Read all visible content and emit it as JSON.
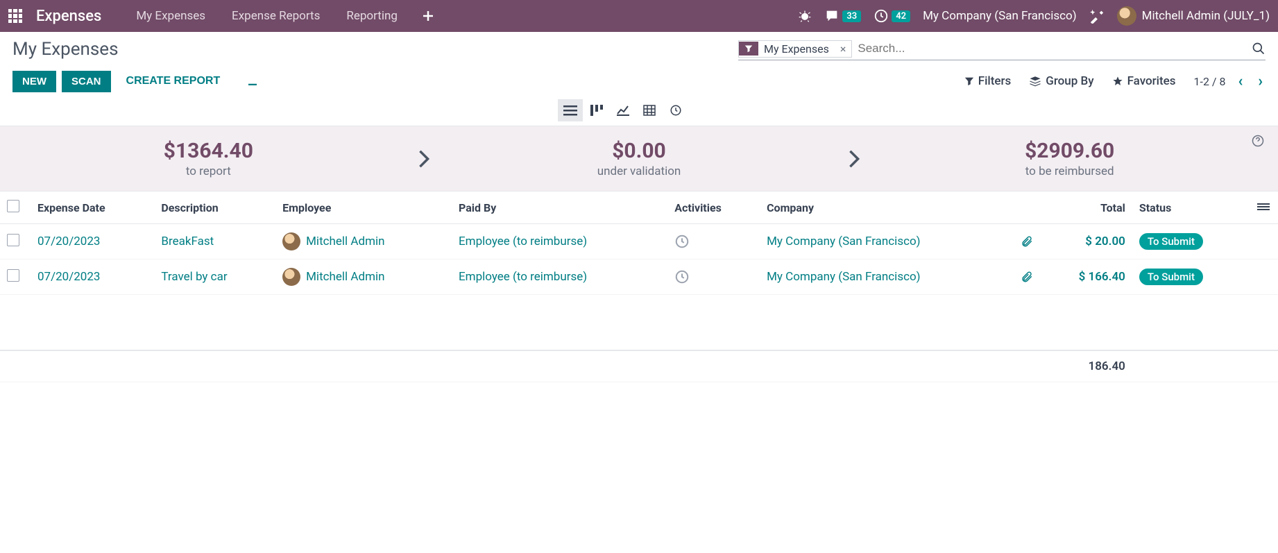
{
  "topbar": {
    "app_name": "Expenses",
    "nav": [
      "My Expenses",
      "Expense Reports",
      "Reporting"
    ],
    "msg_count": "33",
    "activity_count": "42",
    "company": "My Company (San Francisco)",
    "user": "Mitchell Admin (JULY_1)"
  },
  "breadcrumb": "My Expenses",
  "buttons": {
    "new": "NEW",
    "scan": "SCAN",
    "create_report": "CREATE REPORT"
  },
  "search": {
    "chip_label": "My Expenses",
    "placeholder": "Search..."
  },
  "tools": {
    "filters": "Filters",
    "group_by": "Group By",
    "favorites": "Favorites"
  },
  "pager": "1-2 / 8",
  "dashboard": {
    "to_report": {
      "amount": "$1364.40",
      "label": "to report"
    },
    "under_validation": {
      "amount": "$0.00",
      "label": "under validation"
    },
    "to_be_reimbursed": {
      "amount": "$2909.60",
      "label": "to be reimbursed"
    }
  },
  "columns": {
    "expense_date": "Expense Date",
    "description": "Description",
    "employee": "Employee",
    "paid_by": "Paid By",
    "activities": "Activities",
    "company": "Company",
    "total": "Total",
    "status": "Status"
  },
  "rows": [
    {
      "date": "07/20/2023",
      "description": "BreakFast",
      "employee": "Mitchell Admin",
      "paid_by": "Employee (to reimburse)",
      "company": "My Company (San Francisco)",
      "total": "$ 20.00",
      "status": "To Submit"
    },
    {
      "date": "07/20/2023",
      "description": "Travel by car",
      "employee": "Mitchell Admin",
      "paid_by": "Employee (to reimburse)",
      "company": "My Company (San Francisco)",
      "total": "$ 166.40",
      "status": "To Submit"
    }
  ],
  "footer_total": "186.40"
}
